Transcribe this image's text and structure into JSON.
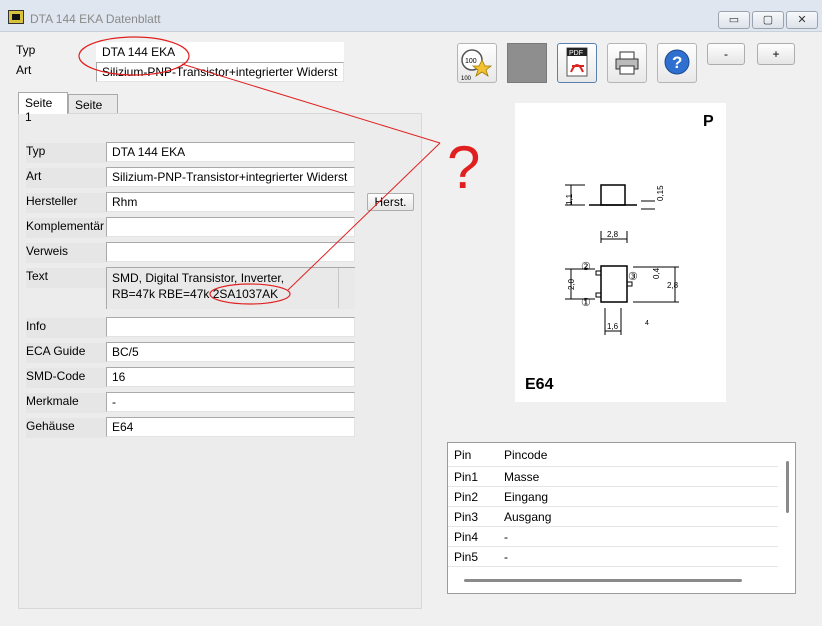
{
  "window": {
    "title": "DTA 144 EKA Datenblatt",
    "minimize": "▭",
    "maximize": "▢",
    "close": "✕"
  },
  "header": {
    "typ_label": "Typ",
    "typ_value": "DTA 144 EKA",
    "art_label": "Art",
    "art_value": "Silizium-PNP-Transistor+integrierter Widerst"
  },
  "toolbar": {
    "minus_label": "-",
    "plus_label": "+",
    "pdf_text": "PDF"
  },
  "tabs": [
    {
      "label": "Seite 1"
    },
    {
      "label": "Seite 2"
    }
  ],
  "fields": {
    "typ": {
      "label": "Typ",
      "value": "DTA 144 EKA"
    },
    "art": {
      "label": "Art",
      "value": "Silizium-PNP-Transistor+integrierter Widerst"
    },
    "hersteller": {
      "label": "Hersteller",
      "value": "Rhm",
      "button": "Herst."
    },
    "komplementaer": {
      "label": "Komplementär",
      "value": ""
    },
    "verweis": {
      "label": "Verweis",
      "value": ""
    },
    "text": {
      "label": "Text",
      "line1": "SMD, Digital Transistor, Inverter,",
      "line2_prefix": "RB=47k RBE=47k ",
      "line2_highlight": "2SA1037AK"
    },
    "info": {
      "label": "Info",
      "value": ""
    },
    "eca_guide": {
      "label": "ECA Guide",
      "value": "BC/5"
    },
    "smd_code": {
      "label": "SMD-Code",
      "value": "16"
    },
    "merkmale": {
      "label": "Merkmale",
      "value": "-"
    },
    "gehaeuse": {
      "label": "Gehäuse",
      "value": "E64"
    }
  },
  "annotation": {
    "question_mark": "?"
  },
  "diagram": {
    "polarity": "P",
    "package": "E64",
    "dim_top_width": "2,8",
    "dim_height_left": "1,1",
    "dim_lead": "0,15",
    "dim_side_left": "2,0",
    "dim_side_right": "2,8",
    "dim_lead_width": "0,4",
    "dim_bottom": "1,6",
    "pin_labels": [
      "①",
      "②",
      "③"
    ],
    "note": "4"
  },
  "pin_table": {
    "headers": [
      "Pin",
      "Pincode"
    ],
    "rows": [
      [
        "Pin1",
        "Masse"
      ],
      [
        "Pin2",
        "Eingang"
      ],
      [
        "Pin3",
        "Ausgang"
      ],
      [
        "Pin4",
        "-"
      ],
      [
        "Pin5",
        "-"
      ]
    ]
  },
  "colors": {
    "annotation_red": "#e02020",
    "window_bg": "#f0f0f0"
  }
}
